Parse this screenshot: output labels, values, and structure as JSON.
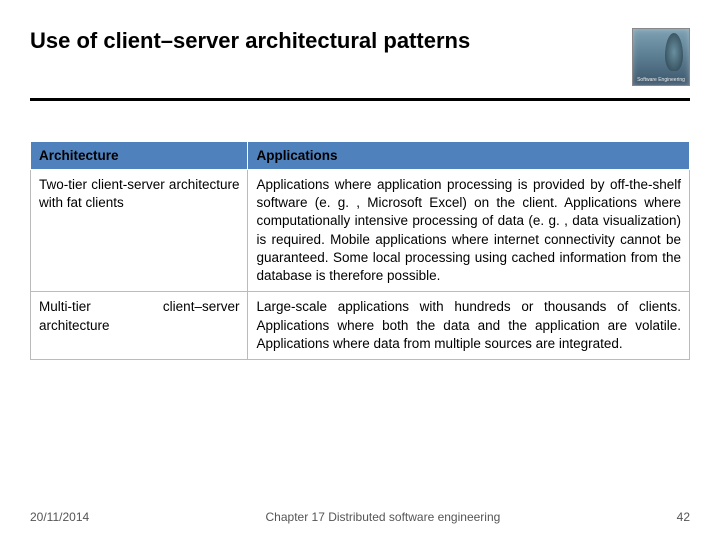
{
  "title": "Use of client–server architectural patterns",
  "logo": {
    "caption": "Software Engineering"
  },
  "table": {
    "headers": [
      "Architecture",
      "Applications"
    ],
    "rows": [
      {
        "arch": "Two-tier client-server architecture with fat clients",
        "apps": "Applications where application processing is provided by off-the-shelf software (e. g. , Microsoft Excel) on the client. Applications where computationally intensive processing of data (e. g. , data visualization) is required. Mobile applications where internet connectivity cannot be guaranteed. Some local processing using cached information from the database is therefore possible."
      },
      {
        "arch": "Multi-tier client–server architecture",
        "apps": "Large-scale applications with hundreds or thousands of clients. Applications where both the data and the application are volatile. Applications where data from multiple sources are integrated."
      }
    ]
  },
  "footer": {
    "date": "20/11/2014",
    "chapter": "Chapter 17 Distributed software engineering",
    "page": "42"
  }
}
